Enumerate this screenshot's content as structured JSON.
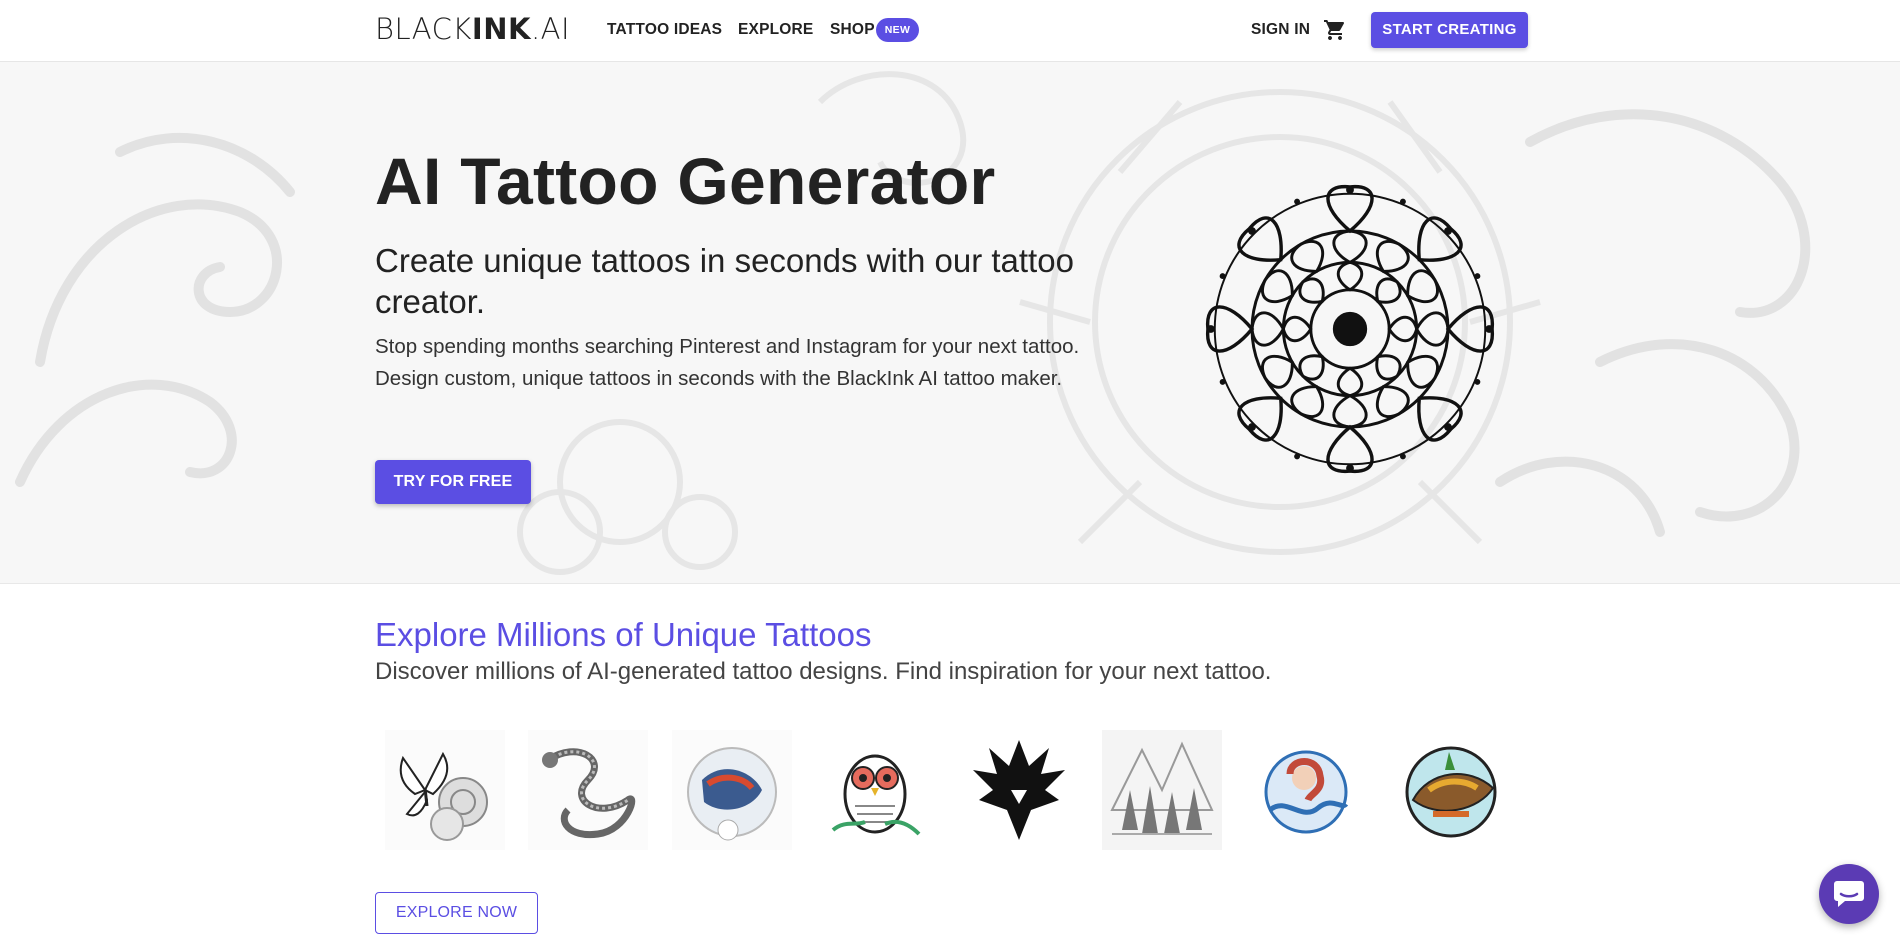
{
  "header": {
    "logo_light": "BLACK",
    "logo_bold": "INK",
    "logo_suffix": ".AI",
    "nav": {
      "tattoo_ideas": "TATTOO IDEAS",
      "explore": "EXPLORE",
      "shop": "SHOP",
      "shop_badge": "NEW"
    },
    "sign_in": "SIGN IN",
    "cart_icon": "shopping-cart-icon",
    "start_creating": "START CREATING"
  },
  "hero": {
    "title": "AI Tattoo Generator",
    "subtitle": "Create unique tattoos in seconds with our tattoo creator.",
    "description": "Stop spending months searching Pinterest and Instagram for your next tattoo. Design custom, unique tattoos in seconds with the BlackInk AI tattoo maker.",
    "cta": "TRY FOR FREE",
    "illustration": "mandala-tattoo"
  },
  "explore": {
    "title": "Explore Millions of Unique Tattoos",
    "subtitle": "Discover millions of AI-generated tattoo designs. Find inspiration for your next tattoo.",
    "gallery": [
      "butterfly-roses-tattoo",
      "dragon-tattoo",
      "koi-fish-tattoo",
      "owl-tattoo",
      "eagle-tattoo",
      "mountain-forest-tattoo",
      "mermaid-wave-tattoo",
      "bird-tattoo"
    ],
    "cta": "EXPLORE NOW"
  },
  "chat_icon": "chat-bubble-icon",
  "colors": {
    "accent": "#5b4ee3",
    "chat": "#5b3bb4",
    "text": "#222222",
    "hero_bg": "#f7f7f7"
  }
}
